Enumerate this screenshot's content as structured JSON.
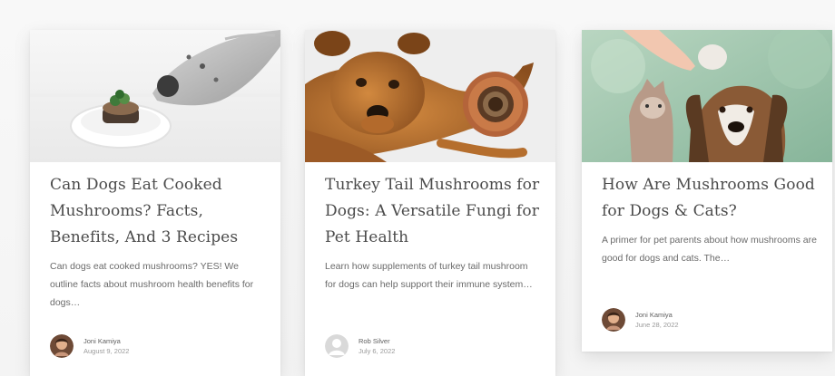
{
  "posts": [
    {
      "title": "Can Dogs Eat Cooked Mushrooms? Facts, Benefits, And 3 Recipes",
      "excerpt": "Can dogs eat cooked mushrooms? YES! We outline facts about mushroom health benefits for dogs…",
      "author": "Joni Kamiya",
      "date": "August 9, 2022",
      "avatar_icon": "author-photo",
      "image_icon": "dog-sniffing-mushroom-plate"
    },
    {
      "title": "Turkey Tail Mushrooms for Dogs: A Versatile Fungi for Pet Health",
      "excerpt": "Learn how supplements of turkey tail mushroom for dogs can help support their immune system…",
      "author": "Rob Silver",
      "date": "July 6, 2022",
      "avatar_icon": "default-user-avatar",
      "image_icon": "dog-with-mushroom-bowl"
    },
    {
      "title": "How Are Mushrooms Good for Dogs & Cats?",
      "excerpt": "A primer for pet parents about how mushrooms are good for dogs and cats. The…",
      "author": "Joni Kamiya",
      "date": "June 28, 2022",
      "avatar_icon": "author-photo",
      "image_icon": "cat-and-basset-hound-with-mushroom"
    }
  ],
  "colors": {
    "title": "#4b4b4b",
    "excerpt": "#6a6a6a",
    "meta": "#9a9a9a",
    "card": "#ffffff"
  }
}
